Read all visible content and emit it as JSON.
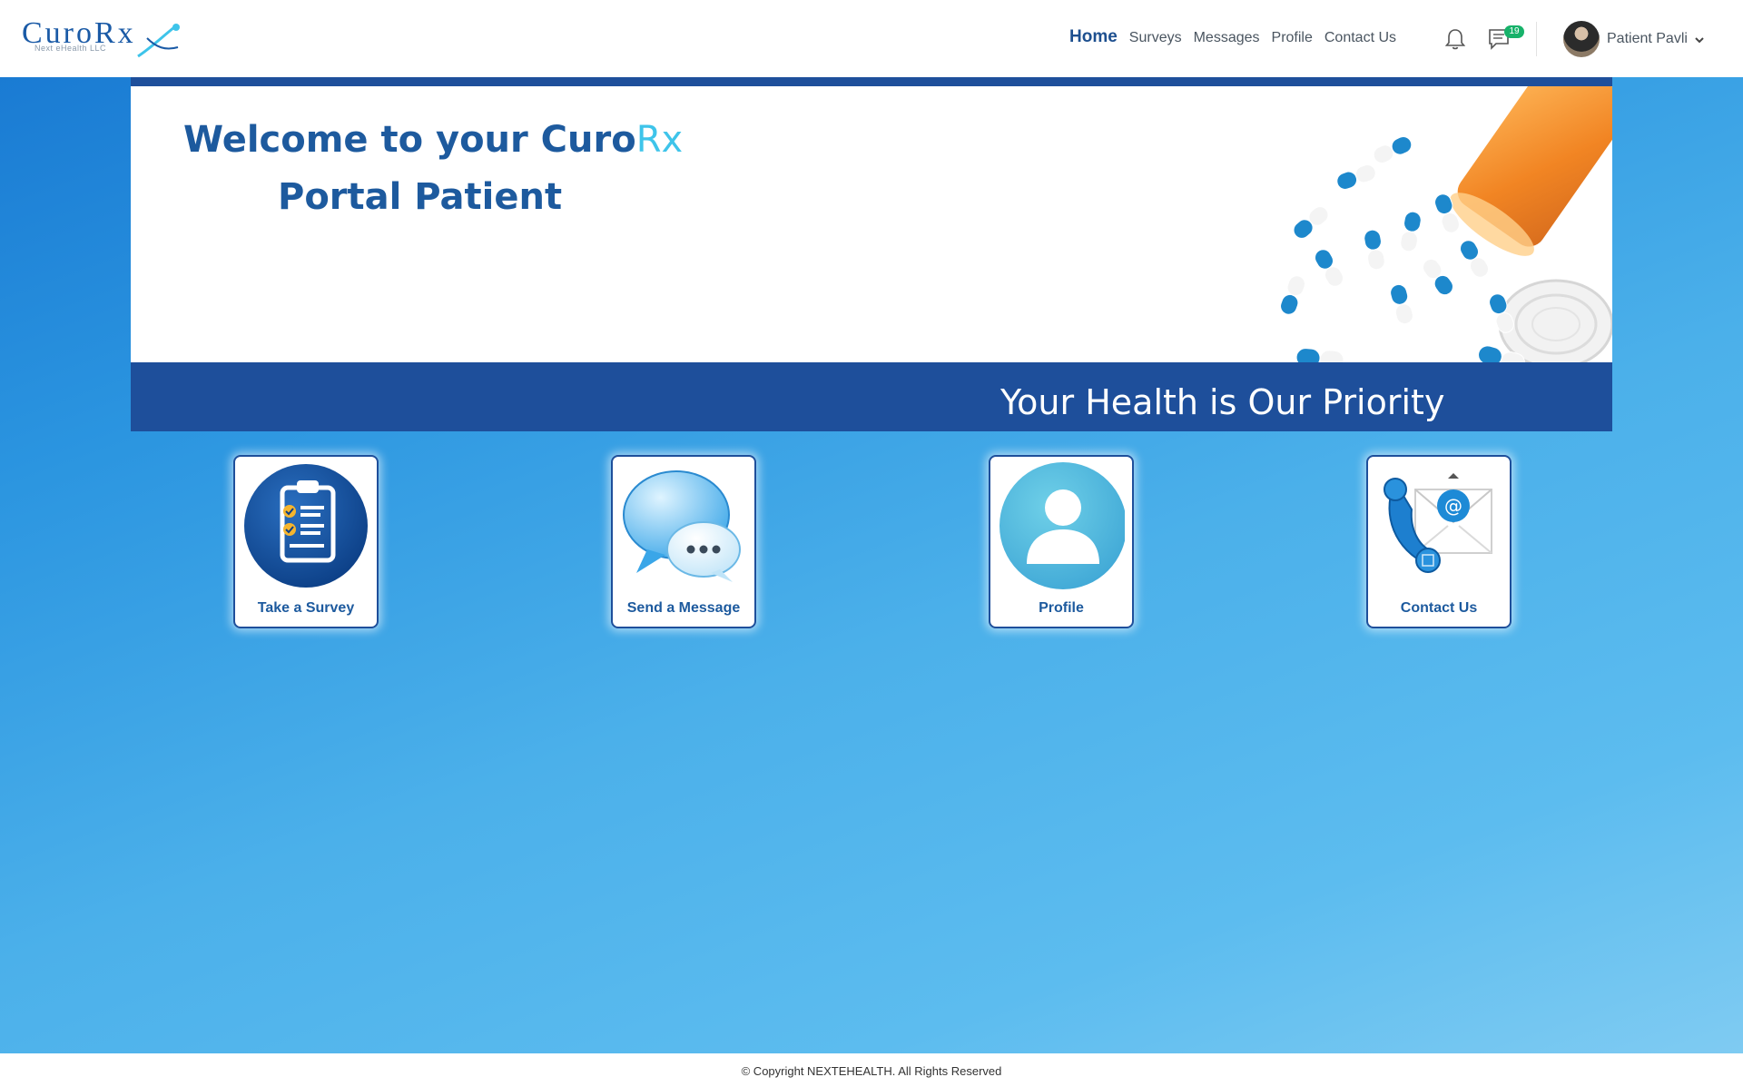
{
  "brand": {
    "logo_text": "CuroRx",
    "logo_sub": "Next eHealth LLC"
  },
  "nav": {
    "items": [
      {
        "label": "Home",
        "active": true
      },
      {
        "label": "Surveys",
        "active": false
      },
      {
        "label": "Messages",
        "active": false
      },
      {
        "label": "Profile",
        "active": false
      },
      {
        "label": "Contact Us",
        "active": false
      }
    ]
  },
  "header": {
    "notification_icon": "bell-icon",
    "messages_icon": "chat-icon",
    "message_count": "19",
    "user_name": "Patient Pavli"
  },
  "banner": {
    "welcome_prefix": "Welcome to your Curo",
    "welcome_rx": "Rx",
    "welcome_line2": "Portal Patient",
    "tagline": "Your Health is Our Priority"
  },
  "tiles": [
    {
      "label": "Take a Survey",
      "icon": "clipboard-checklist-icon"
    },
    {
      "label": "Send a Message",
      "icon": "speech-bubbles-icon"
    },
    {
      "label": "Profile",
      "icon": "user-profile-icon"
    },
    {
      "label": "Contact Us",
      "icon": "phone-envelope-icon"
    }
  ],
  "footer": {
    "copyright": "© Copyright NEXTEHEALTH. All Rights Reserved"
  },
  "colors": {
    "brand_dark": "#1e4f9b",
    "brand_light": "#3ec4ea",
    "badge": "#17b26a"
  }
}
